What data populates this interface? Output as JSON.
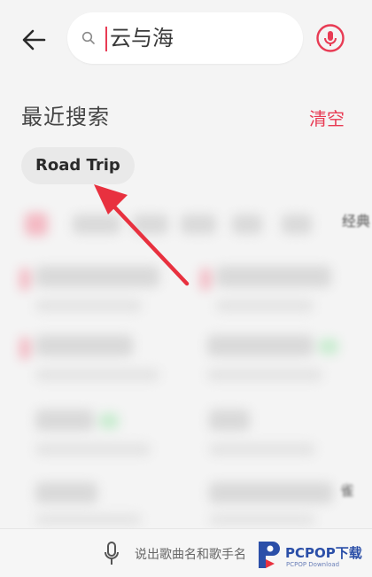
{
  "header": {
    "back_icon": "arrow-left-icon",
    "search": {
      "icon": "search-icon",
      "placeholder": "云与海",
      "value": ""
    },
    "right_icon": "mic-circle-icon"
  },
  "recent": {
    "title": "最近搜索",
    "clear_label": "清空",
    "items": [
      {
        "label": "Road Trip"
      }
    ]
  },
  "blurred_fragments": {
    "tab_tail": "经典",
    "list_tail": "雀"
  },
  "voice_bar": {
    "icon": "microphone-icon",
    "hint": "说出歌曲名和歌手名"
  },
  "watermark": {
    "logo": "pcpop-logo-icon",
    "text": "PCPOP下载",
    "subtext": "PCPOP Download"
  },
  "colors": {
    "accent": "#e83b54",
    "arrow": "#e8313f",
    "chip_bg": "#e9e9e9",
    "page_bg": "#f4f4f4"
  }
}
